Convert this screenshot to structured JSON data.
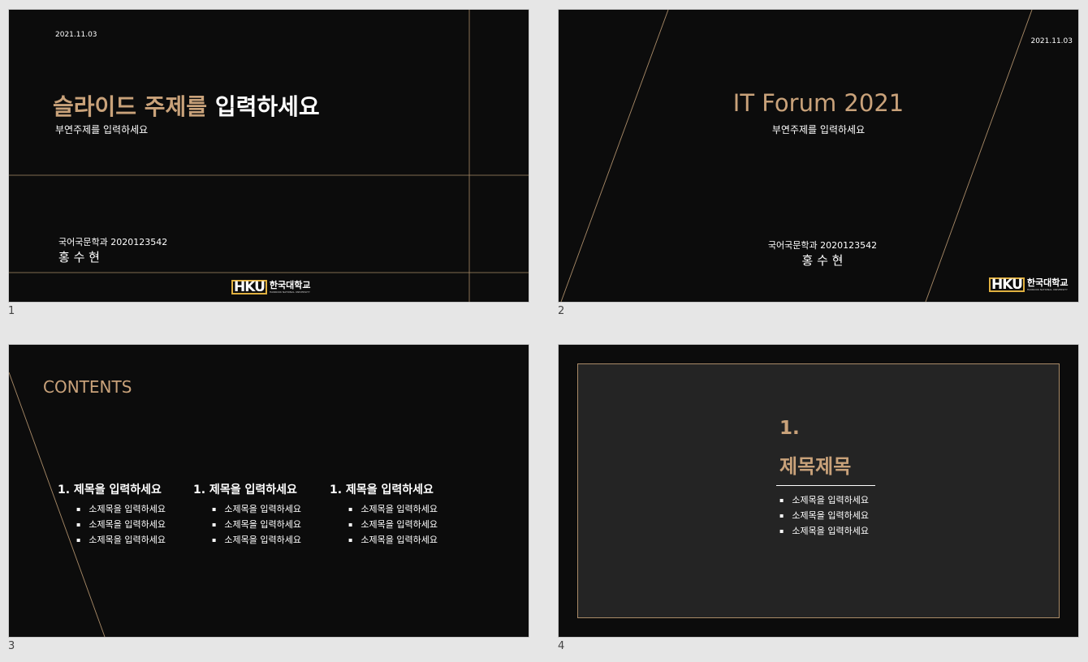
{
  "slides": [
    {
      "number": "1",
      "date": "2021.11.03",
      "title_gold": "슬라이드 주제를",
      "title_white": "입력하세요",
      "subtitle": "부연주제를 입력하세요",
      "dept": "국어국문학과 2020123542",
      "name": "홍 수 현",
      "logo_mark": "HKU",
      "logo_kr": "한국대학교",
      "logo_en": "HANKOOK NATIONAL UNIVERSITY"
    },
    {
      "number": "2",
      "date": "2021.11.03",
      "title": "IT Forum 2021",
      "subtitle": "부연주제를 입력하세요",
      "dept": "국어국문학과 2020123542",
      "name": "홍 수 현",
      "logo_mark": "HKU",
      "logo_kr": "한국대학교",
      "logo_en": "HANKOOK NATIONAL UNIVERSITY"
    },
    {
      "number": "3",
      "title": "CONTENTS",
      "columns": [
        {
          "heading": "1.  제목을 입력하세요",
          "items": [
            "소제목을 입력하세요",
            "소제목을 입력하세요",
            "소제목을 입력하세요"
          ]
        },
        {
          "heading": "1.  제목을 입력하세요",
          "items": [
            "소제목을 입력하세요",
            "소제목을 입력하세요",
            "소제목을 입력하세요"
          ]
        },
        {
          "heading": "1.  제목을 입력하세요",
          "items": [
            "소제목을 입력하세요",
            "소제목을 입력하세요",
            "소제목을 입력하세요"
          ]
        }
      ]
    },
    {
      "number": "4",
      "section_num": "1.",
      "section_title": "제목제목",
      "items": [
        "소제목을 입력하세요",
        "소제목을 입력하세요",
        "소제목을 입력하세요"
      ]
    }
  ],
  "colors": {
    "accent": "#c9a27a",
    "background": "#0c0c0c",
    "panel": "#242424",
    "window": "#e6e6e6"
  }
}
